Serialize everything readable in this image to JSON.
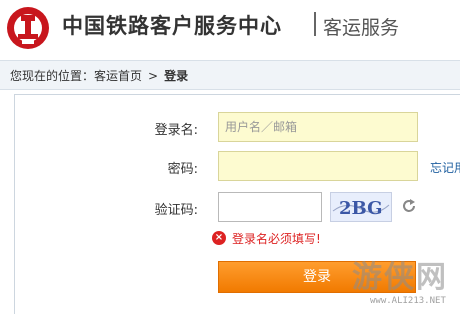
{
  "header": {
    "title": "中国铁路客户服务中心",
    "subtitle": "客运服务"
  },
  "breadcrumb": {
    "prefix": "您现在的位置：",
    "home": "客运首页",
    "separator": ">",
    "current": "登录"
  },
  "form": {
    "username_label": "登录名:",
    "username_placeholder": "用户名／邮箱",
    "password_label": "密码:",
    "password_value": "",
    "forgot_link": "忘记用",
    "captcha_label": "验证码:",
    "captcha_value": "",
    "captcha_image_text": "2BG",
    "error_icon": "×",
    "error_message": "登录名必须填写!",
    "login_button": "登录"
  },
  "watermark": {
    "text": "游侠网",
    "url": "www.ALI213.NET"
  },
  "colors": {
    "accent_orange": "#f17a00",
    "error_red": "#dd2222",
    "field_yellow": "#fdfbd0",
    "logo_red": "#c8161d"
  }
}
